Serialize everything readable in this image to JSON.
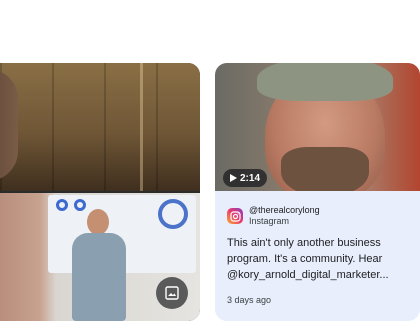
{
  "left_card": {
    "image_button_icon": "image-icon"
  },
  "right_card": {
    "duration": "2:14",
    "play_icon": "play-icon",
    "source_icon": "instagram-icon",
    "account": "@therealcorylong",
    "platform": "Instagram",
    "snippet_lines": [
      "This ain't only another business",
      "program. It's a community. Hear",
      "@kory_arnold_digital_marketer..."
    ],
    "time_ago": "3 days ago"
  },
  "colors": {
    "card_bg": "#e8eefb",
    "badge_bg": "#202124",
    "instagram_gradient_start": "#f7b231",
    "instagram_gradient_end": "#8a3bc0"
  }
}
